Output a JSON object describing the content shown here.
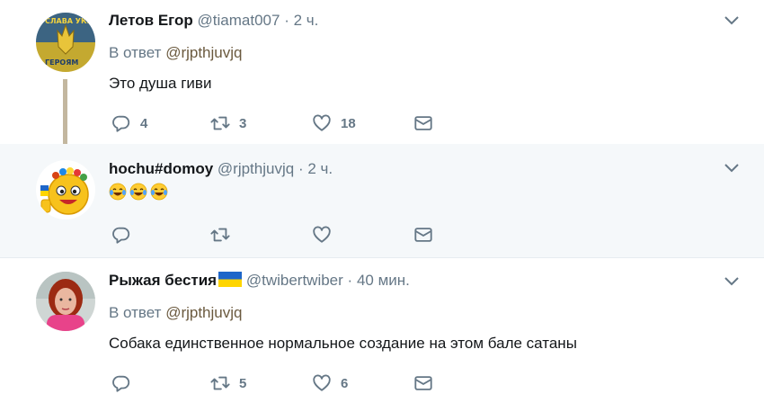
{
  "tweets": [
    {
      "fullname": "Летов Егор",
      "username": "@tiamat007",
      "dot": "·",
      "time": "2 ч.",
      "reply_prefix": "В ответ",
      "reply_to": "@rjpthjuvjq",
      "text": "Это душа гиви",
      "counts": {
        "reply": "4",
        "retweet": "3",
        "like": "18"
      }
    },
    {
      "fullname": "hochu#domoy",
      "username": "@rjpthjuvjq",
      "dot": "·",
      "time": "2 ч.",
      "emojis": [
        "face-with-tears-of-joy-icon",
        "face-with-tears-of-joy-icon",
        "face-with-tears-of-joy-icon"
      ],
      "counts": {
        "reply": "",
        "retweet": "",
        "like": ""
      }
    },
    {
      "fullname": "Рыжая бестия",
      "name_flag": "ukraine-flag-icon",
      "username": "@twibertwiber",
      "dot": "·",
      "time": "40 мин.",
      "reply_prefix": "В ответ",
      "reply_to": "@rjpthjuvjq",
      "text": "Собака единственное нормальное создание на этом бале сатаны",
      "counts": {
        "reply": "",
        "retweet": "5",
        "like": "6"
      }
    }
  ],
  "colors": {
    "text": "#14171a",
    "secondary": "#657786",
    "reply_link": "#6b5a3f",
    "icon": "#657786",
    "thread_line": "#c3b79f",
    "highlight_bg": "#f5f8fa"
  },
  "icons": {
    "reply": "reply-icon",
    "retweet": "retweet-icon",
    "like": "heart-icon",
    "dm": "envelope-icon",
    "more": "chevron-down-icon"
  }
}
